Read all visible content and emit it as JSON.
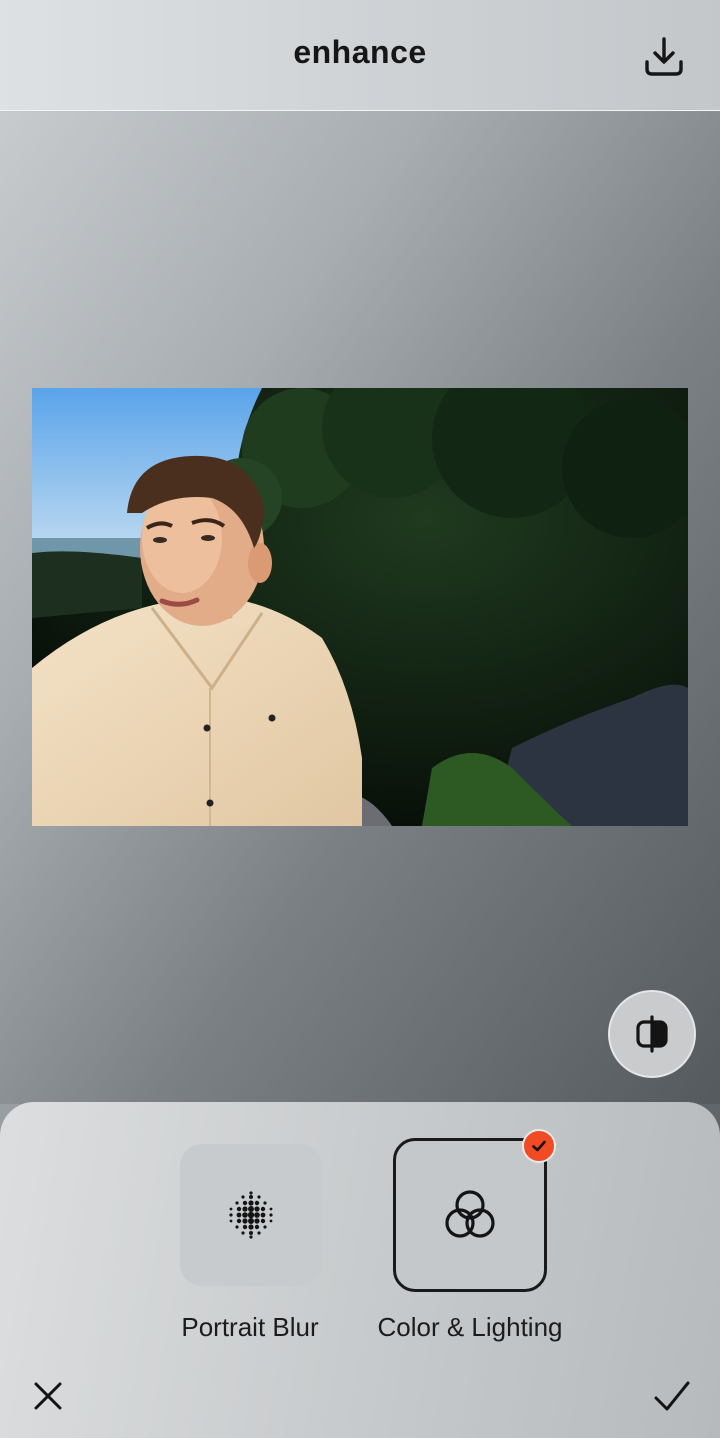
{
  "header": {
    "title": "enhance",
    "download_icon": "download-icon"
  },
  "editor": {
    "compare_icon": "compare-split-icon"
  },
  "tools": [
    {
      "label": "Portrait Blur",
      "icon": "dot-grid-icon",
      "selected": false
    },
    {
      "label": "Color & Lighting",
      "icon": "interlocking-rings-icon",
      "selected": true
    }
  ],
  "actions": {
    "cancel_icon": "close-icon",
    "confirm_icon": "check-icon"
  },
  "colors": {
    "accent": "#f04b25",
    "text": "#161616"
  }
}
